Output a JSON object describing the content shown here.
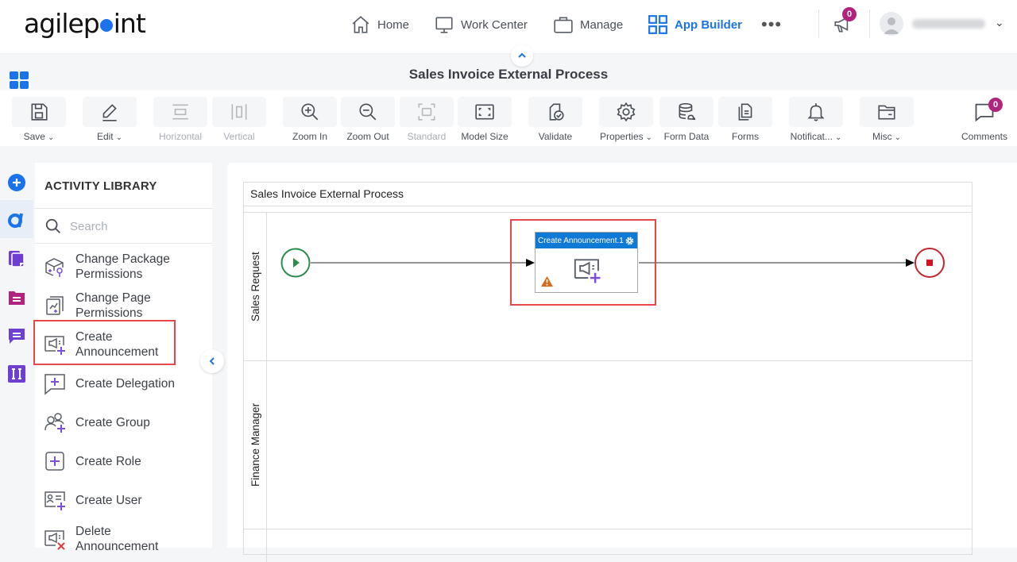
{
  "brand": {
    "logo_text_left": "agilep",
    "logo_text_right": "int"
  },
  "nav": {
    "items": [
      {
        "label": "Home",
        "icon": "home-icon"
      },
      {
        "label": "Work Center",
        "icon": "monitor-icon"
      },
      {
        "label": "Manage",
        "icon": "briefcase-icon"
      },
      {
        "label": "App Builder",
        "icon": "grid-icon",
        "active": true
      }
    ],
    "more": "•••",
    "announcements_count": "0",
    "user_chevron": "⌄"
  },
  "page": {
    "title": "Sales Invoice External Process",
    "collapse_glyph": "⌃"
  },
  "toolbar": {
    "items": [
      {
        "label": "Save",
        "dropdown": true,
        "disabled": false
      },
      {
        "label": "Edit",
        "dropdown": true,
        "disabled": false
      },
      {
        "label": "Horizontal",
        "dropdown": false,
        "disabled": true
      },
      {
        "label": "Vertical",
        "dropdown": false,
        "disabled": true
      },
      {
        "label": "Zoom In",
        "dropdown": false,
        "disabled": false
      },
      {
        "label": "Zoom Out",
        "dropdown": false,
        "disabled": false
      },
      {
        "label": "Standard",
        "dropdown": false,
        "disabled": true
      },
      {
        "label": "Model Size",
        "dropdown": false,
        "disabled": false
      },
      {
        "label": "Validate",
        "dropdown": false,
        "disabled": false
      },
      {
        "label": "Properties",
        "dropdown": true,
        "disabled": false
      },
      {
        "label": "Form Data",
        "dropdown": false,
        "disabled": false
      },
      {
        "label": "Forms",
        "dropdown": false,
        "disabled": false
      },
      {
        "label": "Notificat...",
        "dropdown": true,
        "disabled": false
      },
      {
        "label": "Misc",
        "dropdown": true,
        "disabled": false
      }
    ],
    "comments_label": "Comments",
    "comments_count": "0",
    "chevron": "❯"
  },
  "library": {
    "title": "ACTIVITY LIBRARY",
    "search_placeholder": "Search",
    "items": [
      {
        "label": "Change Package Permissions"
      },
      {
        "label": "Change Page Permissions"
      },
      {
        "label": "Create Announcement",
        "highlighted": true
      },
      {
        "label": "Create Delegation"
      },
      {
        "label": "Create Group"
      },
      {
        "label": "Create Role"
      },
      {
        "label": "Create User"
      },
      {
        "label": "Delete Announcement"
      }
    ],
    "collapse_glyph": "‹"
  },
  "process": {
    "pool_title": "Sales Invoice External Process",
    "lanes": [
      "Sales Request",
      "Finance Manager"
    ],
    "activity": {
      "title": "Create Announcement.1",
      "has_warning": true
    },
    "colors": {
      "start": "#2e8b4e",
      "end": "#c0282d",
      "activity_header": "#0f79d6",
      "highlight": "#e8474a",
      "accent": "#1a73e8"
    }
  }
}
